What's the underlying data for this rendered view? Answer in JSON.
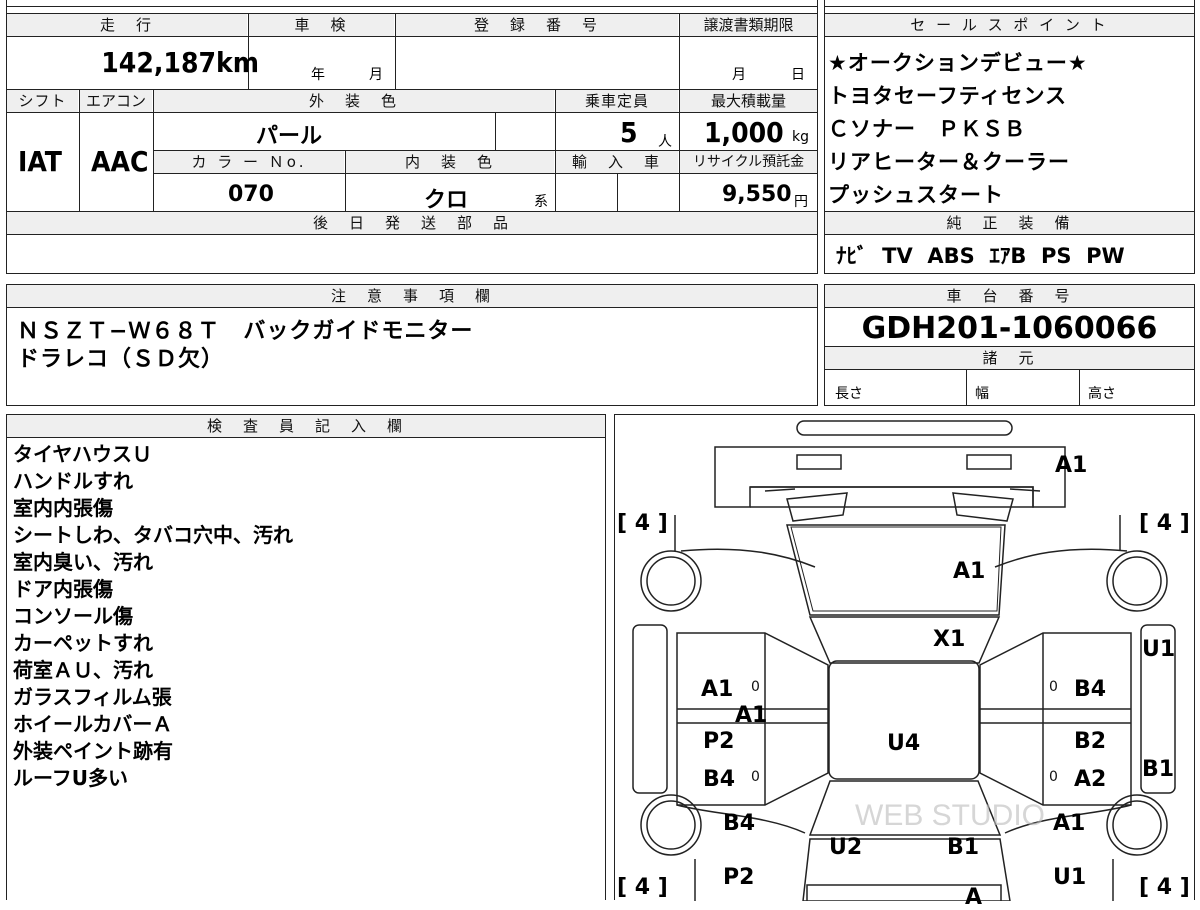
{
  "top": {
    "mileage_label": "走　行",
    "shaken_label": "車　検",
    "reg_no_label": "登　録　番　号",
    "transfer_deadline_label": "譲渡書類期限",
    "mileage_value": "142,187",
    "mileage_unit": "km",
    "year_unit": "年",
    "month_unit": "月",
    "deadline_month": "月",
    "deadline_day": "日",
    "shift_label": "シフト",
    "ac_label": "エアコン",
    "exterior_color_label": "外　装　色",
    "capacity_label": "乗車定員",
    "max_load_label": "最大積載量",
    "shift_value": "IAT",
    "ac_value": "AAC",
    "exterior_color_value": "パール",
    "capacity_value": "5",
    "capacity_unit": "人",
    "max_load_value": "1,000",
    "max_load_unit": "kg",
    "color_no_label": "カ ラ ー Ｎo.",
    "interior_color_label": "内　装　色",
    "import_label": "輸　入　車",
    "recycle_label": "リサイクル預託金",
    "color_no_value": "070",
    "interior_color_value": "クロ",
    "interior_color_suffix": "系",
    "recycle_value": "9,550",
    "recycle_unit": "円",
    "later_parts_label": "後　日　発　送　部　品",
    "later_parts_value": ""
  },
  "sales_points": {
    "header": "セ ー ル ス ポ イ ン ト",
    "items": [
      "★オークションデビュー★",
      "トヨタセーフティセンス",
      "Ｃソナー　ＰＫＳＢ",
      "リアヒーター＆クーラー",
      "プッシュスタート"
    ]
  },
  "genuine_equipment": {
    "header": "純　正　装　備",
    "value": "ﾅﾋﾞ  TV  ABS  ｴｱB  PS  PW"
  },
  "notes": {
    "header": "注　意　事　項　欄",
    "lines": [
      "ＮＳＺＴ−Ｗ６８Ｔ　バックガイドモニター",
      "ドラレコ（ＳＤ欠）"
    ]
  },
  "chassis": {
    "header": "車　台　番　号",
    "value": "GDH201-1060066",
    "specs_header": "諸　元",
    "length_label": "長さ",
    "width_label": "幅",
    "height_label": "高さ"
  },
  "inspector": {
    "header": "検　査　員　記　入　欄",
    "lines": [
      "タイヤハウスＵ",
      "ハンドルすれ",
      "室内内張傷",
      "シートしわ、タバコ穴中、汚れ",
      "室内臭い、汚れ",
      "ドア内張傷",
      "コンソール傷",
      "カーペットすれ",
      "荷室ＡＵ、汚れ",
      "ガラスフィルム張",
      "ホイールカバーＡ",
      "外装ペイント跡有",
      "ルーフU多い"
    ]
  },
  "diagram": {
    "tire_tread": "4",
    "marks": {
      "front_bumper": "A1",
      "hood": "A1",
      "windshield": "X1",
      "left_fender": "A1",
      "left_front_door_upper": "A1",
      "left_front_door_zero": "0",
      "left_rear_door_p2": "P2",
      "left_rear_door_b4": "B4",
      "left_rear_door_zero": "0",
      "left_quarter_b4": "B4",
      "left_quarter_p2": "P2",
      "roof": "U4",
      "right_fender_u1": "U1",
      "right_front_door_b4": "B4",
      "right_front_door_zero": "0",
      "right_rear_door_b2": "B2",
      "right_rear_door_a2": "A2",
      "right_rear_door_zero": "0",
      "right_side_b1": "B1",
      "right_quarter_a1": "A1",
      "right_quarter_u1": "U1",
      "rear_glass_u2": "U2",
      "rear_glass_b1": "B1",
      "rear_bumper": "A"
    },
    "watermark": "WEB STUDIO"
  }
}
